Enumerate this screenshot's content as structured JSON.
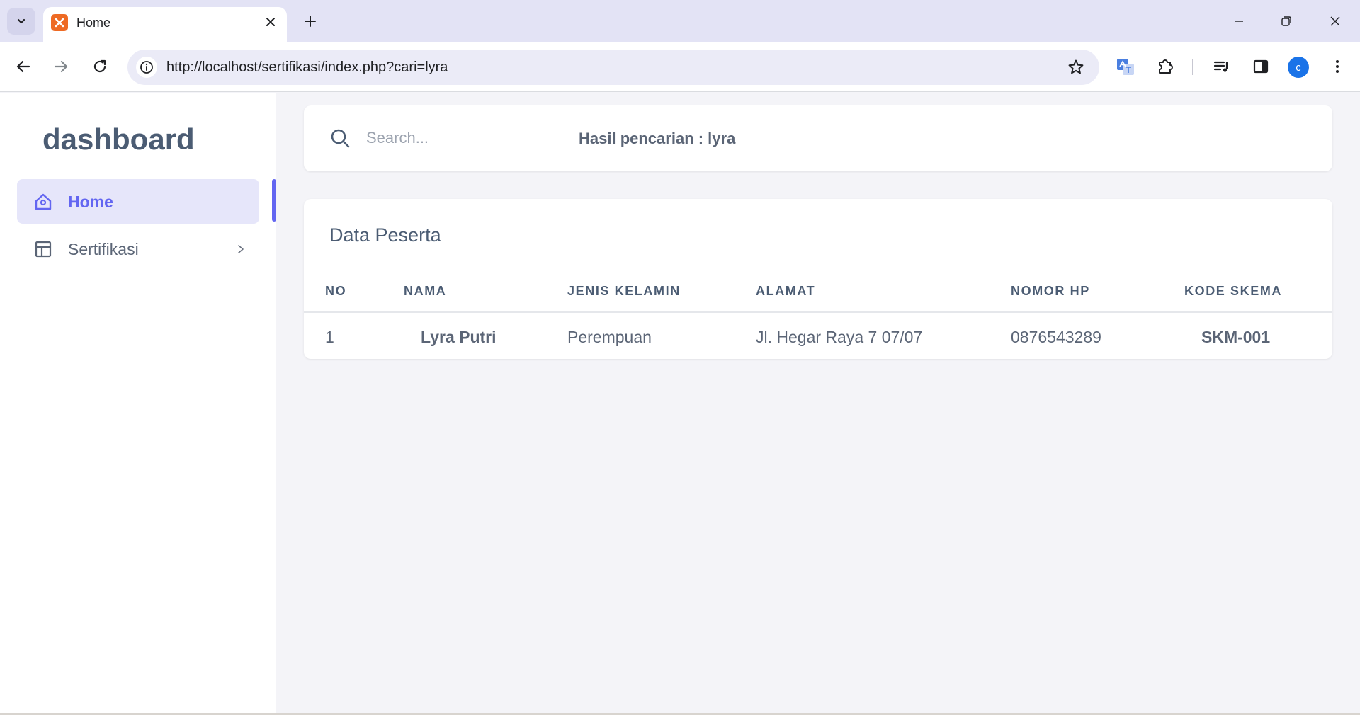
{
  "browser": {
    "tab_title": "Home",
    "url": "http://localhost/sertifikasi/index.php?cari=lyra",
    "profile_initial": "c"
  },
  "sidebar": {
    "brand": "dashboard",
    "items": [
      {
        "label": "Home",
        "icon": "home-icon",
        "active": true
      },
      {
        "label": "Sertifikasi",
        "icon": "layout-icon",
        "active": false
      }
    ]
  },
  "search": {
    "placeholder": "Search...",
    "result_text": "Hasil pencarian : lyra"
  },
  "table": {
    "title": "Data Peserta",
    "columns": [
      "NO",
      "NAMA",
      "JENIS KELAMIN",
      "ALAMAT",
      "NOMOR HP",
      "KODE SKEMA"
    ],
    "rows": [
      [
        "1",
        "Lyra Putri",
        "Perempuan",
        "Jl. Hegar Raya 7 07/07",
        "0876543289",
        "SKM-001"
      ]
    ]
  },
  "colors": {
    "accent": "#6366f1",
    "tab_strip": "#e3e3f5",
    "page_bg": "#f4f4f8",
    "favicon": "#ee6a24"
  }
}
